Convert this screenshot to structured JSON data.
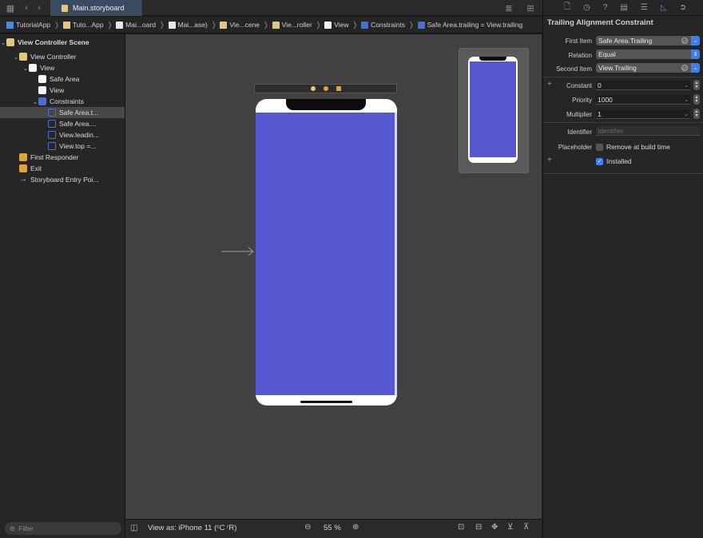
{
  "tabs": [
    {
      "label": "Main.storyboard"
    }
  ],
  "breadcrumb": [
    {
      "label": "TutorialApp",
      "icon": "project-icon",
      "color": "#4a8be0"
    },
    {
      "label": "Tuto...App",
      "icon": "folder-icon",
      "color": "#e4c77d"
    },
    {
      "label": "Mai...oard",
      "icon": "storyboard-file-icon",
      "color": "#e8e8e8"
    },
    {
      "label": "Mai...ase)",
      "icon": "storyboard-file-icon",
      "color": "#e8e8e8"
    },
    {
      "label": "Vie...cene",
      "icon": "scene-icon",
      "color": "#e4c77d"
    },
    {
      "label": "Vie...roller",
      "icon": "view-controller-icon",
      "color": "#e4c77d"
    },
    {
      "label": "View",
      "icon": "view-icon",
      "color": "#f4f4f4"
    },
    {
      "label": "Constraints",
      "icon": "constraints-icon",
      "color": "#4a6fd0"
    },
    {
      "label": "Safe Area.trailing = View.trailing",
      "icon": "constraint-icon",
      "color": "#4a6fd0"
    }
  ],
  "navigator": {
    "scene_title": "View Controller Scene",
    "items": [
      {
        "label": "View Controller",
        "icon": "view-controller-icon",
        "color": "#e4c77d"
      },
      {
        "label": "View",
        "icon": "view-icon",
        "color": "#f4f4f4"
      },
      {
        "label": "Safe Area",
        "icon": "safe-area-icon",
        "color": "#f4f4f4"
      },
      {
        "label": "View",
        "icon": "view-icon",
        "color": "#f4f4f4"
      },
      {
        "label": "Constraints",
        "icon": "constraints-icon",
        "color": "#4a6fd0"
      },
      {
        "label": "Safe Area.t...",
        "icon": "constraint-icon",
        "color": "#4a6fd0"
      },
      {
        "label": "Safe Area....",
        "icon": "constraint-icon",
        "color": "#4a6fd0"
      },
      {
        "label": "View.leadin...",
        "icon": "constraint-icon",
        "color": "#4a6fd0"
      },
      {
        "label": "View.top =...",
        "icon": "constraint-icon",
        "color": "#4a6fd0"
      },
      {
        "label": "First Responder",
        "icon": "first-responder-icon",
        "color": "#e4a23a"
      },
      {
        "label": "Exit",
        "icon": "exit-icon",
        "color": "#e4a23a"
      },
      {
        "label": "Storyboard Entry Poi...",
        "icon": "arrow-right-icon",
        "color": "#cfcfcf"
      }
    ],
    "filter_placeholder": "Filter"
  },
  "bottom_bar": {
    "view_as": "View as: iPhone 11 (ᶜC ʳR)",
    "zoom": "55 %"
  },
  "inspector": {
    "title": "Trailing Alignment Constraint",
    "first_item_label": "First Item",
    "first_item_value": "Safe Area.Trailing",
    "relation_label": "Relation",
    "relation_value": "Equal",
    "second_item_label": "Second Item",
    "second_item_value": "View.Trailing",
    "constant_label": "Constant",
    "constant_value": "0",
    "priority_label": "Priority",
    "priority_value": "1000",
    "multiplier_label": "Multiplier",
    "multiplier_value": "1",
    "identifier_label": "Identifier",
    "identifier_placeholder": "Identifier",
    "placeholder_label": "Placeholder",
    "placeholder_checkbox": "Remove at build time",
    "placeholder_checked": false,
    "installed_checkbox": "Installed",
    "installed_checked": true
  },
  "colors": {
    "view_background": "#5558d0",
    "accent": "#3d7ef2",
    "selection": "#474747"
  }
}
